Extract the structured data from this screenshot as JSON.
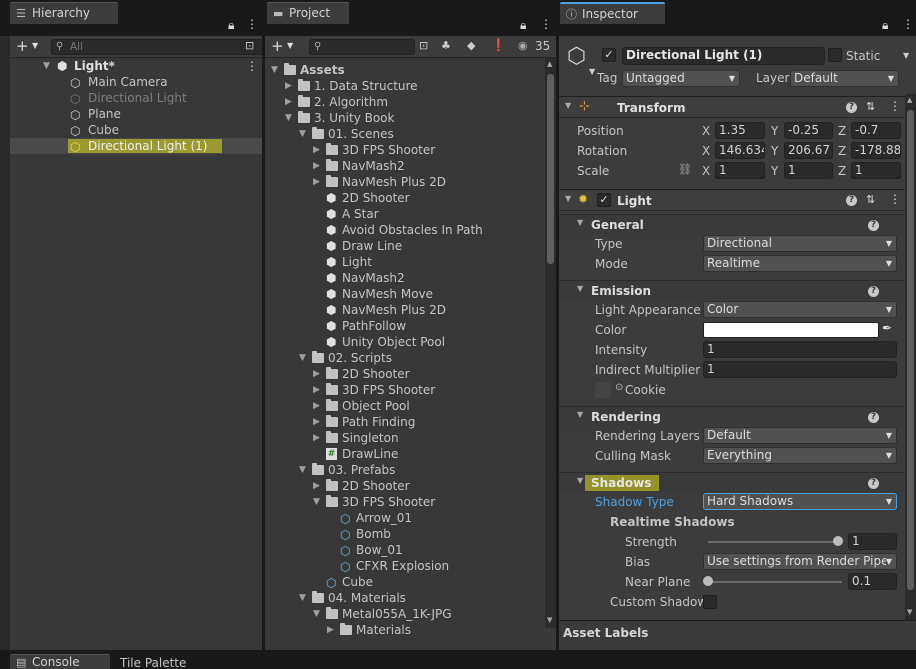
{
  "hierarchy": {
    "tab_label": "Hierarchy",
    "search_placeholder": "All",
    "items": [
      {
        "label": "Light*"
      },
      {
        "label": "Main Camera"
      },
      {
        "label": "Directional Light"
      },
      {
        "label": "Plane"
      },
      {
        "label": "Cube"
      },
      {
        "label": "Directional Light (1)"
      }
    ]
  },
  "project": {
    "tab_label": "Project",
    "search_value": "",
    "hidden_count": "35",
    "tree": [
      {
        "label": "Assets"
      },
      {
        "label": "1. Data Structure"
      },
      {
        "label": "2. Algorithm"
      },
      {
        "label": "3. Unity Book"
      },
      {
        "label": "01. Scenes"
      },
      {
        "label": "3D FPS Shooter"
      },
      {
        "label": "NavMash2"
      },
      {
        "label": "NavMesh Plus 2D"
      },
      {
        "label": "2D Shooter"
      },
      {
        "label": "A Star"
      },
      {
        "label": "Avoid Obstacles In Path"
      },
      {
        "label": "Draw Line"
      },
      {
        "label": "Light"
      },
      {
        "label": "NavMash2"
      },
      {
        "label": "NavMesh Move"
      },
      {
        "label": "NavMesh Plus 2D"
      },
      {
        "label": "PathFollow"
      },
      {
        "label": "Unity Object Pool"
      },
      {
        "label": "02. Scripts"
      },
      {
        "label": "2D Shooter"
      },
      {
        "label": "3D FPS Shooter"
      },
      {
        "label": "Object Pool"
      },
      {
        "label": "Path Finding"
      },
      {
        "label": "Singleton"
      },
      {
        "label": "DrawLine"
      },
      {
        "label": "03. Prefabs"
      },
      {
        "label": "2D Shooter"
      },
      {
        "label": "3D FPS Shooter"
      },
      {
        "label": "Arrow_01"
      },
      {
        "label": "Bomb"
      },
      {
        "label": "Bow_01"
      },
      {
        "label": "CFXR Explosion"
      },
      {
        "label": "Cube"
      },
      {
        "label": "04. Materials"
      },
      {
        "label": "Metal055A_1K-JPG"
      },
      {
        "label": "Materials"
      }
    ]
  },
  "inspector": {
    "tab_label": "Inspector",
    "object_name": "Directional Light (1)",
    "static_label": "Static",
    "tag_label": "Tag",
    "tag_value": "Untagged",
    "layer_label": "Layer",
    "layer_value": "Default",
    "transform": {
      "title": "Transform",
      "position_label": "Position",
      "rotation_label": "Rotation",
      "scale_label": "Scale",
      "x": "X",
      "y": "Y",
      "z": "Z",
      "position": [
        "1.35",
        "-0.25",
        "-0.7"
      ],
      "rotation": [
        "146.634",
        "206.67",
        "-178.88"
      ],
      "scale": [
        "1",
        "1",
        "1"
      ]
    },
    "light": {
      "title": "Light",
      "general": "General",
      "type_label": "Type",
      "type_value": "Directional",
      "mode_label": "Mode",
      "mode_value": "Realtime",
      "emission": "Emission",
      "appearance_label": "Light Appearance",
      "appearance_value": "Color",
      "color_label": "Color",
      "color_value": "#ffffff",
      "intensity_label": "Intensity",
      "intensity_value": "1",
      "indirect_label": "Indirect Multiplier",
      "indirect_value": "1",
      "cookie_label": "Cookie",
      "rendering": "Rendering",
      "rendering_layers_label": "Rendering Layers",
      "rendering_layers_value": "Default",
      "culling_label": "Culling Mask",
      "culling_value": "Everything",
      "shadows": "Shadows",
      "shadow_type_label": "Shadow Type",
      "shadow_type_value": "Hard Shadows",
      "realtime_shadows": "Realtime Shadows",
      "strength_label": "Strength",
      "strength_value": "1",
      "bias_label": "Bias",
      "bias_value": "Use settings from Render Pipel",
      "near_plane_label": "Near Plane",
      "near_plane_value": "0.1",
      "custom_shadow_label": "Custom Shadow"
    },
    "asset_labels": "Asset Labels"
  },
  "bottom_tabs": {
    "console": "Console",
    "tile_palette": "Tile Palette"
  },
  "colors": {
    "highlight": "#dedc1e",
    "accent_blue": "#4c9fe0",
    "folder_icon": "#c2c2c2",
    "prefab_icon": "#5fb9ef"
  }
}
